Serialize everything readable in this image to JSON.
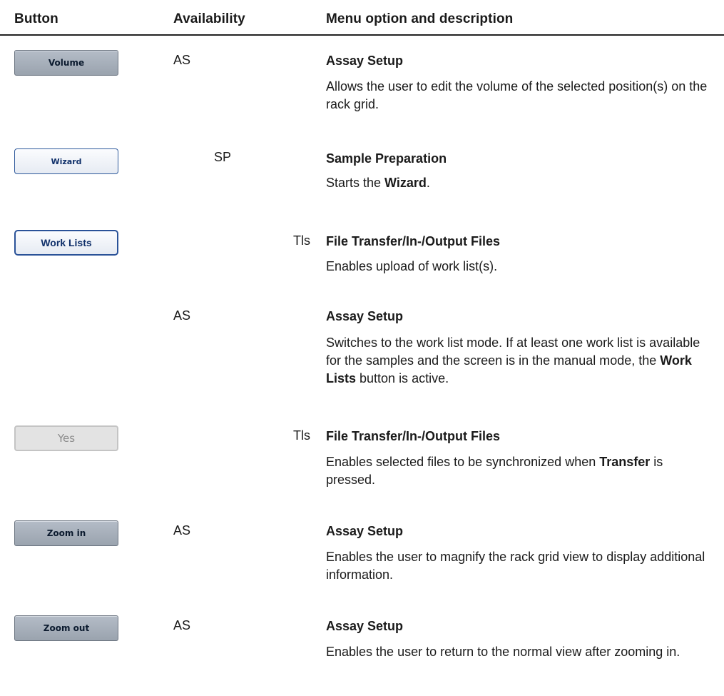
{
  "headers": {
    "button": "Button",
    "availability": "Availability",
    "menu": "Menu option and description"
  },
  "rows": [
    {
      "button": "Volume",
      "availability": "AS",
      "title": "Assay Setup",
      "desc": "Allows the user to edit the volume of the selected position(s) on the rack grid."
    },
    {
      "button": "Wizard",
      "availability": "SP",
      "title": "Sample Preparation",
      "desc_pre": "Starts the ",
      "desc_bold": "Wizard",
      "desc_post": "."
    },
    {
      "button": "Work Lists",
      "availability": "Tls",
      "title": "File Transfer/In-/Output Files",
      "desc": "Enables upload of work list(s)."
    },
    {
      "availability": "AS",
      "title": "Assay Setup",
      "desc_pre": "Switches to the work list mode. If at least one work list is available for the samples and the screen is in the manual mode, the ",
      "desc_bold": "Work Lists",
      "desc_post": " button is active."
    },
    {
      "button": "Yes",
      "availability": "Tls",
      "title": "File Transfer/In-/Output Files",
      "desc_pre": "Enables selected files to be synchronized when ",
      "desc_bold": "Transfer",
      "desc_post": " is pressed."
    },
    {
      "button": "Zoom in",
      "availability": "AS",
      "title": "Assay Setup",
      "desc": "Enables the user to magnify the rack grid view to display additional information."
    },
    {
      "button": "Zoom out",
      "availability": "AS",
      "title": "Assay Setup",
      "desc": "Enables the user to return to the normal view after zooming in."
    }
  ]
}
